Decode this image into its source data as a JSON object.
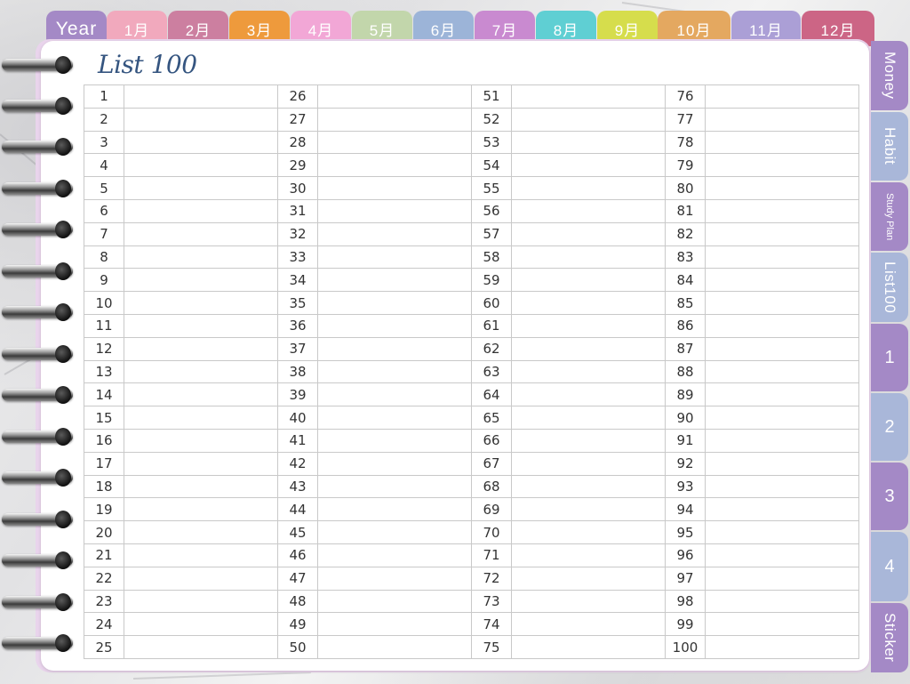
{
  "top_tabs": [
    {
      "label": "Year",
      "color": "#a489c6"
    },
    {
      "label": "1月",
      "color": "#f1a9bd"
    },
    {
      "label": "2月",
      "color": "#cc7fa0"
    },
    {
      "label": "3月",
      "color": "#ee9a3c"
    },
    {
      "label": "4月",
      "color": "#f2a7d6"
    },
    {
      "label": "5月",
      "color": "#c2d6ab"
    },
    {
      "label": "6月",
      "color": "#9cb4d8"
    },
    {
      "label": "7月",
      "color": "#c98ad0"
    },
    {
      "label": "8月",
      "color": "#5fcfd3"
    },
    {
      "label": "9月",
      "color": "#d6dd4c"
    },
    {
      "label": "10月",
      "color": "#e4a860"
    },
    {
      "label": "11月",
      "color": "#ab9fd6"
    },
    {
      "label": "12月",
      "color": "#cc6585"
    }
  ],
  "title": "List 100",
  "list": {
    "numbers": [
      1,
      2,
      3,
      4,
      5,
      6,
      7,
      8,
      9,
      10,
      11,
      12,
      13,
      14,
      15,
      16,
      17,
      18,
      19,
      20,
      21,
      22,
      23,
      24,
      25,
      26,
      27,
      28,
      29,
      30,
      31,
      32,
      33,
      34,
      35,
      36,
      37,
      38,
      39,
      40,
      41,
      42,
      43,
      44,
      45,
      46,
      47,
      48,
      49,
      50,
      51,
      52,
      53,
      54,
      55,
      56,
      57,
      58,
      59,
      60,
      61,
      62,
      63,
      64,
      65,
      66,
      67,
      68,
      69,
      70,
      71,
      72,
      73,
      74,
      75,
      76,
      77,
      78,
      79,
      80,
      81,
      82,
      83,
      84,
      85,
      86,
      87,
      88,
      89,
      90,
      91,
      92,
      93,
      94,
      95,
      96,
      97,
      98,
      99,
      100
    ]
  },
  "side_tabs": [
    {
      "label": "Money",
      "color": "#a489c6",
      "style": "v"
    },
    {
      "label": "Habit",
      "color": "#a9b7d9",
      "style": "v"
    },
    {
      "label": "Study Plan",
      "color": "#a489c6",
      "style": "small"
    },
    {
      "label": "List100",
      "color": "#a9b7d9",
      "style": "v"
    },
    {
      "label": "1",
      "color": "#a489c6",
      "style": "n"
    },
    {
      "label": "2",
      "color": "#a9b7d9",
      "style": "n"
    },
    {
      "label": "3",
      "color": "#a489c6",
      "style": "n"
    },
    {
      "label": "4",
      "color": "#a9b7d9",
      "style": "n"
    },
    {
      "label": "Sticker",
      "color": "#a489c6",
      "style": "v"
    }
  ]
}
